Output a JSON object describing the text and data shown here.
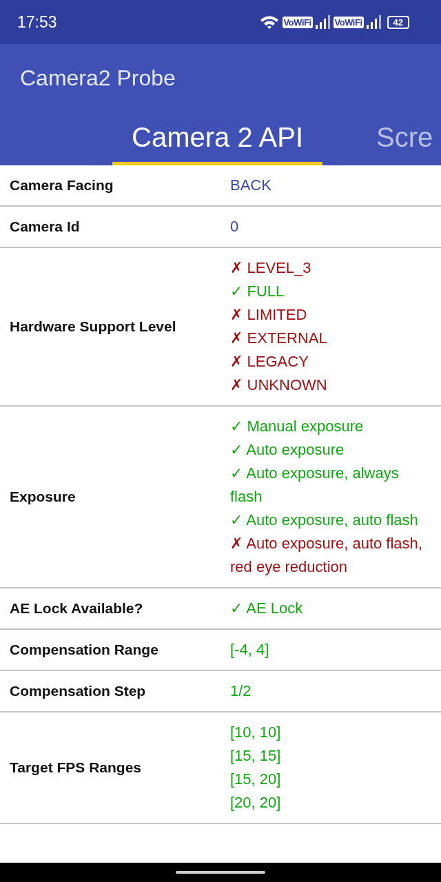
{
  "status_bar": {
    "time": "17:53",
    "badges": [
      "VoWiFi",
      "VoWiFi"
    ],
    "battery": "42"
  },
  "app_bar": {
    "title": "Camera2 Probe"
  },
  "tabs": [
    {
      "label": "Camera 2 API",
      "selected": true
    },
    {
      "label": "Scre",
      "selected": false
    }
  ],
  "rows": [
    {
      "label": "Camera Facing",
      "values": [
        {
          "kind": "info",
          "text": "BACK"
        }
      ]
    },
    {
      "label": "Camera Id",
      "values": [
        {
          "kind": "info",
          "text": "0"
        }
      ]
    },
    {
      "label": "Hardware Support Level",
      "values": [
        {
          "kind": "no",
          "mark": "✗",
          "text": "LEVEL_3"
        },
        {
          "kind": "yes",
          "mark": "✓",
          "text": "FULL"
        },
        {
          "kind": "no",
          "mark": "✗",
          "text": "LIMITED"
        },
        {
          "kind": "no",
          "mark": "✗",
          "text": "EXTERNAL"
        },
        {
          "kind": "no",
          "mark": "✗",
          "text": "LEGACY"
        },
        {
          "kind": "no",
          "mark": "✗",
          "text": "UNKNOWN"
        }
      ]
    },
    {
      "label": "Exposure",
      "values": [
        {
          "kind": "yes",
          "mark": "✓",
          "text": "Manual exposure"
        },
        {
          "kind": "yes",
          "mark": "✓",
          "text": "Auto exposure"
        },
        {
          "kind": "yes",
          "mark": "✓",
          "text": "Auto exposure, always flash"
        },
        {
          "kind": "yes",
          "mark": "✓",
          "text": "Auto exposure, auto flash"
        },
        {
          "kind": "no",
          "mark": "✗",
          "text": "Auto exposure, auto flash, red eye reduction"
        }
      ]
    },
    {
      "label": "AE Lock Available?",
      "values": [
        {
          "kind": "yes",
          "mark": "✓",
          "text": "AE Lock"
        }
      ]
    },
    {
      "label": "Compensation Range",
      "values": [
        {
          "kind": "value",
          "text": "[-4, 4]"
        }
      ]
    },
    {
      "label": "Compensation Step",
      "values": [
        {
          "kind": "value",
          "text": "1/2"
        }
      ]
    },
    {
      "label": "Target FPS Ranges",
      "values": [
        {
          "kind": "value",
          "text": "[10, 10]"
        },
        {
          "kind": "value",
          "text": "[15, 15]"
        },
        {
          "kind": "value",
          "text": "[15, 20]"
        },
        {
          "kind": "value",
          "text": "[20, 20]"
        }
      ]
    }
  ]
}
